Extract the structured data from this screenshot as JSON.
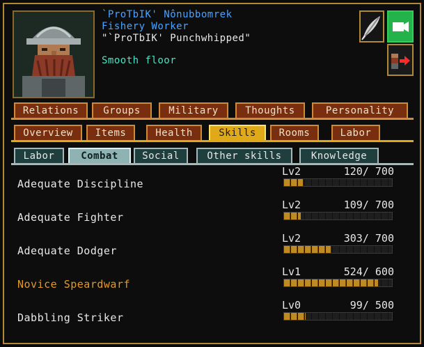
{
  "unit": {
    "name": "`ProTbIK' Nônubbomrek",
    "profession": "Fishery Worker",
    "nickname": "\"`ProTbIK' Punchwhipped\"",
    "location": "Smooth floor"
  },
  "icons": {
    "feather": "quill-feather-icon",
    "camera": "camera-icon",
    "goto": "dwarf-goto-arrow-icon"
  },
  "tabs_row1": [
    "Relations",
    "Groups",
    "Military",
    "Thoughts",
    "Personality"
  ],
  "tabs_row2": [
    "Overview",
    "Items",
    "Health",
    "Skills",
    "Rooms",
    "Labor"
  ],
  "tabs_row2_active": "Skills",
  "tabs_row3": [
    "Labor",
    "Combat",
    "Social",
    "Other skills",
    "Knowledge"
  ],
  "tabs_row3_active": "Combat",
  "skills": [
    {
      "name": "Adequate Discipline",
      "level": "Lv2",
      "xp": "120/ 700",
      "progress": 0.171,
      "color": "#e8e8e8"
    },
    {
      "name": "Adequate Fighter",
      "level": "Lv2",
      "xp": "109/ 700",
      "progress": 0.156,
      "color": "#e8e8e8"
    },
    {
      "name": "Adequate Dodger",
      "level": "Lv2",
      "xp": "303/ 700",
      "progress": 0.433,
      "color": "#e8e8e8"
    },
    {
      "name": "Novice Speardwarf",
      "level": "Lv1",
      "xp": "524/ 600",
      "progress": 0.873,
      "color": "#e09a2a"
    },
    {
      "name": "Dabbling Striker",
      "level": "Lv0",
      "xp": " 99/ 500",
      "progress": 0.198,
      "color": "#e8e8e8"
    }
  ],
  "colors": {
    "accent_gold": "#e0a91a",
    "name_blue": "#4aa3ff",
    "location_teal": "#46e6c4",
    "camera_green": "#24b24a"
  }
}
